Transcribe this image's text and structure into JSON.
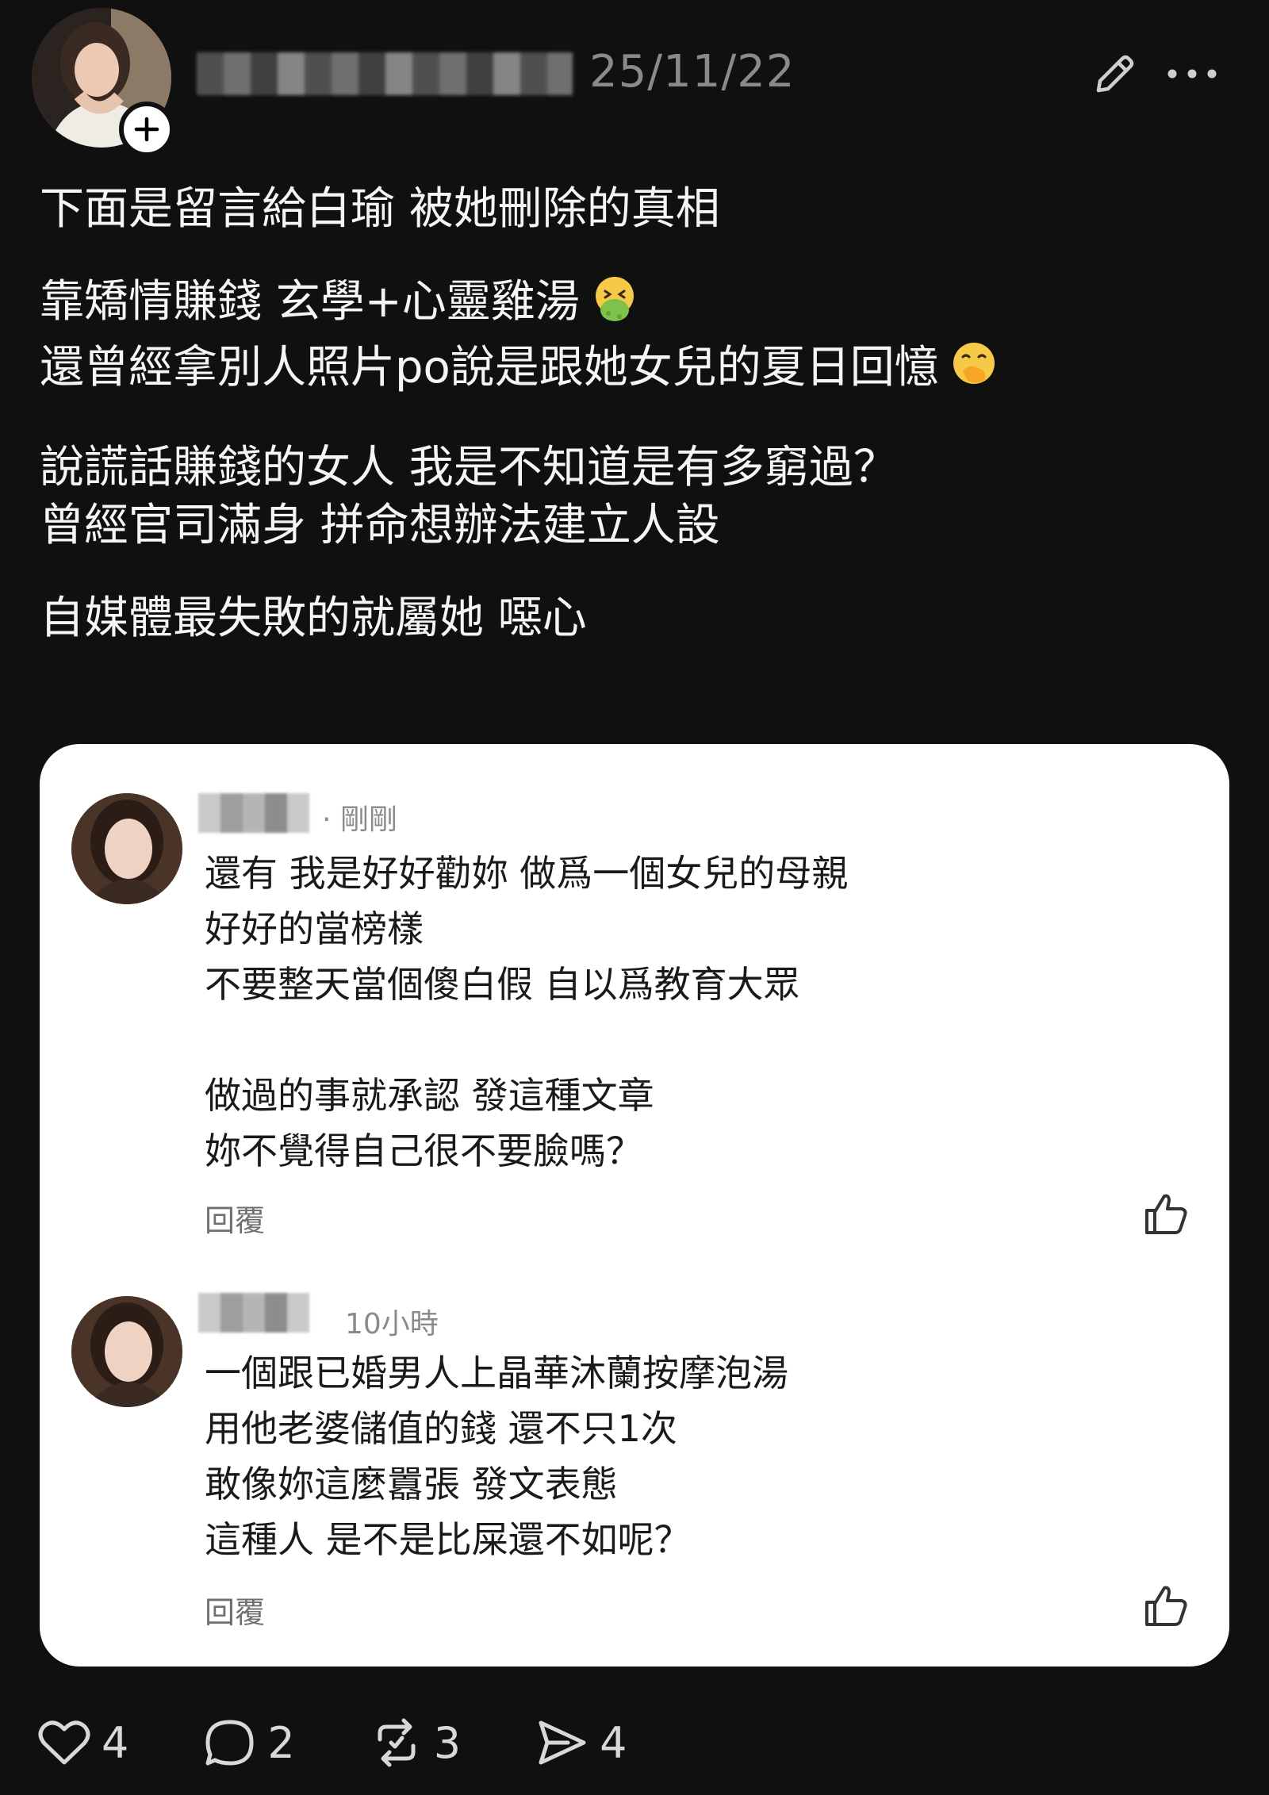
{
  "header": {
    "date": "25/11/22"
  },
  "post": {
    "lines": [
      "下面是留言給白瑜 被她刪除的真相",
      "靠矯情賺錢 玄學+心靈雞湯",
      "還曾經拿別人照片po說是跟她女兒的夏日回憶",
      "說謊話賺錢的女人 我是不知道是有多窮過？",
      "曾經官司滿身 拼命想辦法建立人設",
      "自媒體最失敗的就屬她 噁心"
    ]
  },
  "comments": [
    {
      "time": "· 剛剛",
      "text": "還有 我是好好勸妳 做爲一個女兒的母親\n好好的當榜樣\n不要整天當個傻白假 自以爲教育大眾\n\n做過的事就承認 發這種文章\n妳不覺得自己很不要臉嗎？",
      "reply": "回覆"
    },
    {
      "time": "10小時",
      "text": "一個跟已婚男人上晶華沐蘭按摩泡湯\n用他老婆儲值的錢 還不只1次\n敢像妳這麼囂張 發文表態\n這種人 是不是比屎還不如呢？",
      "reply": "回覆"
    }
  ],
  "actions": {
    "likes": "4",
    "comments": "2",
    "reposts": "3",
    "shares": "4"
  },
  "colors": {
    "background": "#101010",
    "text": "#f3f5f7",
    "muted": "#8a8a8a",
    "card": "#ffffff"
  }
}
